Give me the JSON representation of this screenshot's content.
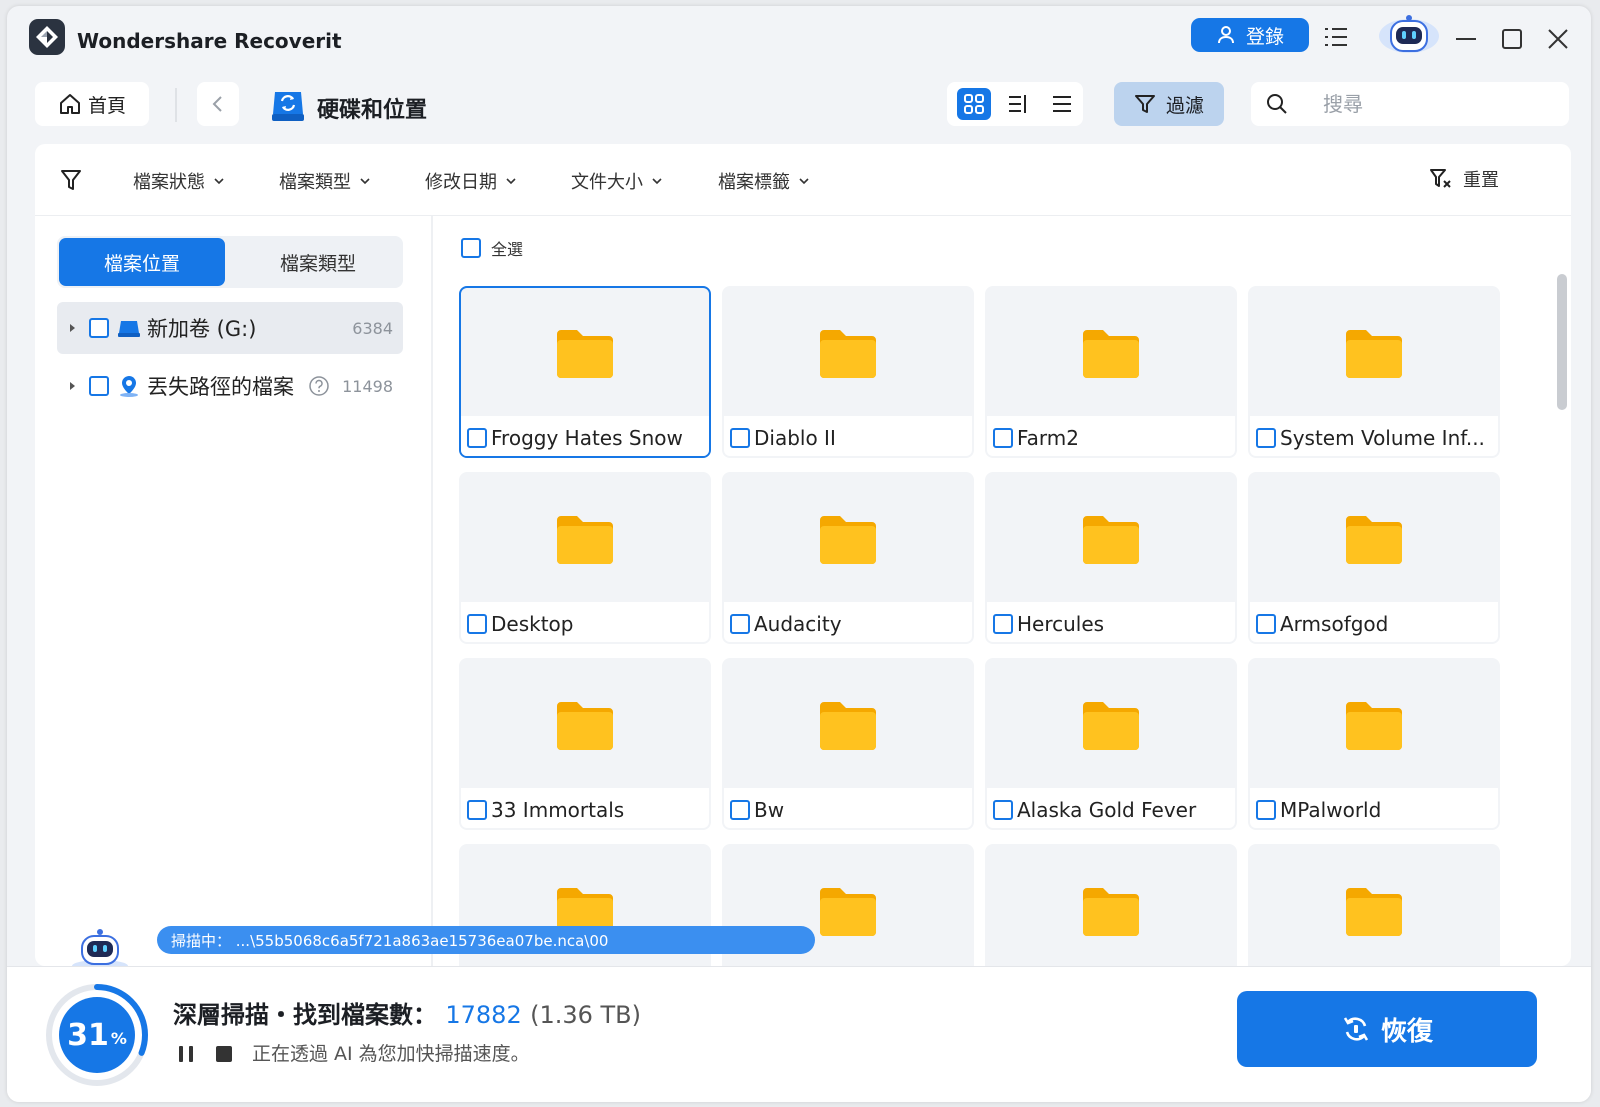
{
  "app": {
    "title": "Wondershare Recoverit",
    "accent": "#1677e6",
    "folder_color": "#ffc21f"
  },
  "header": {
    "login_label": "登錄",
    "icons": [
      "list-icon",
      "robot-avatar-icon",
      "minimize-icon",
      "maximize-icon",
      "close-icon"
    ]
  },
  "toolbar": {
    "home_label": "首頁",
    "location_title": "硬碟和位置",
    "view_modes": [
      "grid",
      "list",
      "details"
    ],
    "active_view": "grid",
    "filter_label": "過濾",
    "search_placeholder": "搜尋"
  },
  "filters": {
    "items": [
      "檔案狀態",
      "檔案類型",
      "修改日期",
      "文件大小",
      "檔案標籤"
    ],
    "reset_label": "重置"
  },
  "sidebar": {
    "tabs": [
      "檔案位置",
      "檔案類型"
    ],
    "active_tab": "檔案位置",
    "tree": [
      {
        "label": "新加卷 (G:)",
        "count": "6384",
        "selected": true
      },
      {
        "label": "丟失路徑的檔案",
        "count": "11498",
        "selected": false
      }
    ]
  },
  "content": {
    "select_all_label": "全選",
    "folders": [
      {
        "name": "Froggy Hates Snow",
        "selected": true
      },
      {
        "name": "Diablo II"
      },
      {
        "name": "Farm2"
      },
      {
        "name": "System Volume Inf..."
      },
      {
        "name": "Desktop"
      },
      {
        "name": "Audacity"
      },
      {
        "name": "Hercules"
      },
      {
        "name": "Armsofgod"
      },
      {
        "name": "33 Immortals"
      },
      {
        "name": "Bw"
      },
      {
        "name": "Alaska Gold Fever"
      },
      {
        "name": "MPalworld"
      },
      {
        "name": ""
      },
      {
        "name": ""
      },
      {
        "name": ""
      },
      {
        "name": ""
      }
    ]
  },
  "scan": {
    "path_text": "掃描中： ...\\55b5068c6a5f721a863ae15736ea07be.nca\\00",
    "percent": 31,
    "percent_label": "31",
    "percent_unit": "%",
    "title": "深層掃描・找到檔案數：",
    "count": "17882",
    "size": "(1.36 TB)",
    "subtitle": "正在透過 AI 為您加快掃描速度。",
    "recover_label": "恢復"
  }
}
